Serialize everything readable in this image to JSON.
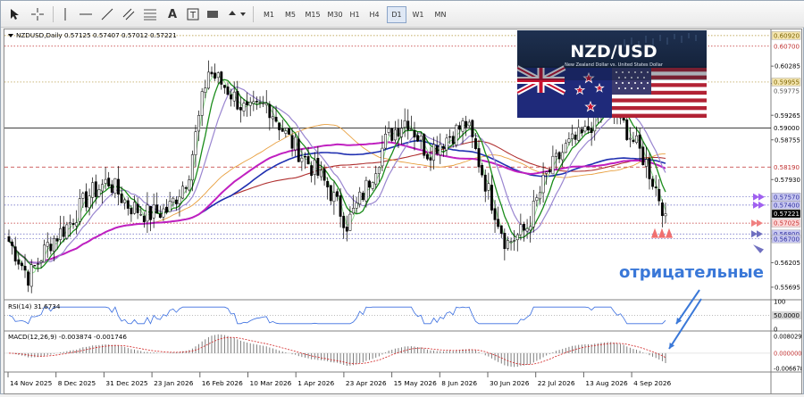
{
  "toolbar": {
    "timeframes": [
      "M1",
      "M5",
      "M15",
      "M30",
      "H1",
      "H4",
      "D1",
      "W1",
      "MN"
    ],
    "active_timeframe": "D1"
  },
  "chart": {
    "symbol_info": "NZDUSD,Daily  0.57125 0.57407 0.57012 0.57221",
    "rsi_label": "RSI(14) 31.6734",
    "macd_label": "MACD(12,26,9) -0.003874 -0.001746",
    "annotation": "отрицательные",
    "banner_title": "NZD/USD",
    "banner_subtitle": "New Zealand Dollar vs. United States Dollar"
  },
  "price_axis": {
    "range": [
      0.5549,
      0.6101
    ],
    "plain_ticks": [
      "0.60285",
      "0.59925",
      "0.59265",
      "0.58755",
      "0.57930",
      "0.57480",
      "0.56700",
      "0.56205",
      "0.55695"
    ],
    "levels": [
      {
        "label": "0.60920",
        "value": 0.6092,
        "color": "#f5e6b0",
        "text": "#7a6200",
        "style": "dot"
      },
      {
        "label": "0.60700",
        "value": 0.607,
        "color": "#ffffff",
        "text": "#c03030",
        "style": "dot"
      },
      {
        "label": "0.59955",
        "value": 0.59955,
        "color": "#f5e6b0",
        "text": "#7a6200",
        "style": "dot"
      },
      {
        "label": "0.59775",
        "value": 0.59775,
        "color": "#ffffff",
        "text": "#555555",
        "style": "none"
      },
      {
        "label": "0.59000",
        "value": 0.59,
        "color": "#ffffff",
        "text": "#000000",
        "style": "solid"
      },
      {
        "label": "0.58190",
        "value": 0.5819,
        "color": "#ffffff",
        "text": "#c03030",
        "style": "dash"
      },
      {
        "label": "0.57570",
        "value": 0.5757,
        "color": "#c8c8f0",
        "text": "#3030a0",
        "style": "dot"
      },
      {
        "label": "0.57400",
        "value": 0.574,
        "color": "#c8c8f0",
        "text": "#3030a0",
        "style": "dot"
      },
      {
        "label": "0.57221",
        "value": 0.57221,
        "color": "#000000",
        "text": "#ffffff",
        "style": "none"
      },
      {
        "label": "0.57025",
        "value": 0.57025,
        "color": "#ffd8d8",
        "text": "#c03030",
        "style": "dot"
      },
      {
        "label": "0.56800",
        "value": 0.568,
        "color": "#c8c8f0",
        "text": "#3030a0",
        "style": "dot"
      },
      {
        "label": "0.56700",
        "value": 0.567,
        "color": "#c8c8f0",
        "text": "#3030a0",
        "style": "dot"
      }
    ]
  },
  "rsi_axis": {
    "ticks": [
      "100",
      "50.0000",
      "0"
    ]
  },
  "macd_axis": {
    "ticks": [
      "0.008029",
      "0.000000",
      "-0.006678"
    ]
  },
  "date_axis": {
    "labels": [
      "14 Nov 2025",
      "8 Dec 2025",
      "31 Dec 2025",
      "23 Jan 2026",
      "16 Feb 2026",
      "10 Mar 2026",
      "1 Apr 2026",
      "23 Apr 2026",
      "15 May 2026",
      "8 Jun 2026",
      "30 Jun 2026",
      "22 Jul 2026",
      "13 Aug 2026",
      "4 Sep 2026"
    ]
  },
  "colors": {
    "candle": "#000000",
    "ma_green": "#1a8c1a",
    "ma_lightgreen": "#90e090",
    "ma_lavender": "#9a86d0",
    "ma_orange": "#e8a040",
    "ma_blue": "#1f2fb0",
    "ma_magenta": "#c020c0",
    "ma_darkred": "#b03030",
    "rsi": "#3a6ee0",
    "macd_hist": "#707070",
    "macd_signal": "#d02020",
    "annotation": "#3a78d8"
  },
  "chart_data": {
    "type": "candlestick",
    "symbol": "NZDUSD",
    "timeframe": "Daily",
    "last": {
      "open": 0.57125,
      "high": 0.57407,
      "low": 0.57012,
      "close": 0.57221
    },
    "x": [
      "14 Nov 2025",
      "8 Dec 2025",
      "31 Dec 2025",
      "23 Jan 2026",
      "16 Feb 2026",
      "10 Mar 2026",
      "1 Apr 2026",
      "23 Apr 2026",
      "15 May 2026",
      "8 Jun 2026",
      "30 Jun 2026",
      "22 Jul 2026",
      "13 Aug 2026",
      "4 Sep 2026"
    ],
    "close_path": [
      0.5665,
      0.559,
      0.566,
      0.57,
      0.576,
      0.579,
      0.574,
      0.572,
      0.573,
      0.58,
      0.602,
      0.598,
      0.593,
      0.595,
      0.588,
      0.583,
      0.578,
      0.57,
      0.578,
      0.588,
      0.592,
      0.585,
      0.588,
      0.591,
      0.578,
      0.566,
      0.569,
      0.58,
      0.586,
      0.589,
      0.596,
      0.59,
      0.583,
      0.5722
    ],
    "ylim": [
      0.5549,
      0.6101
    ],
    "rsi_last": 31.6734,
    "macd_last": -0.003874,
    "macd_signal_last": -0.001746,
    "macd_range": [
      -0.006678,
      0.008029
    ]
  }
}
